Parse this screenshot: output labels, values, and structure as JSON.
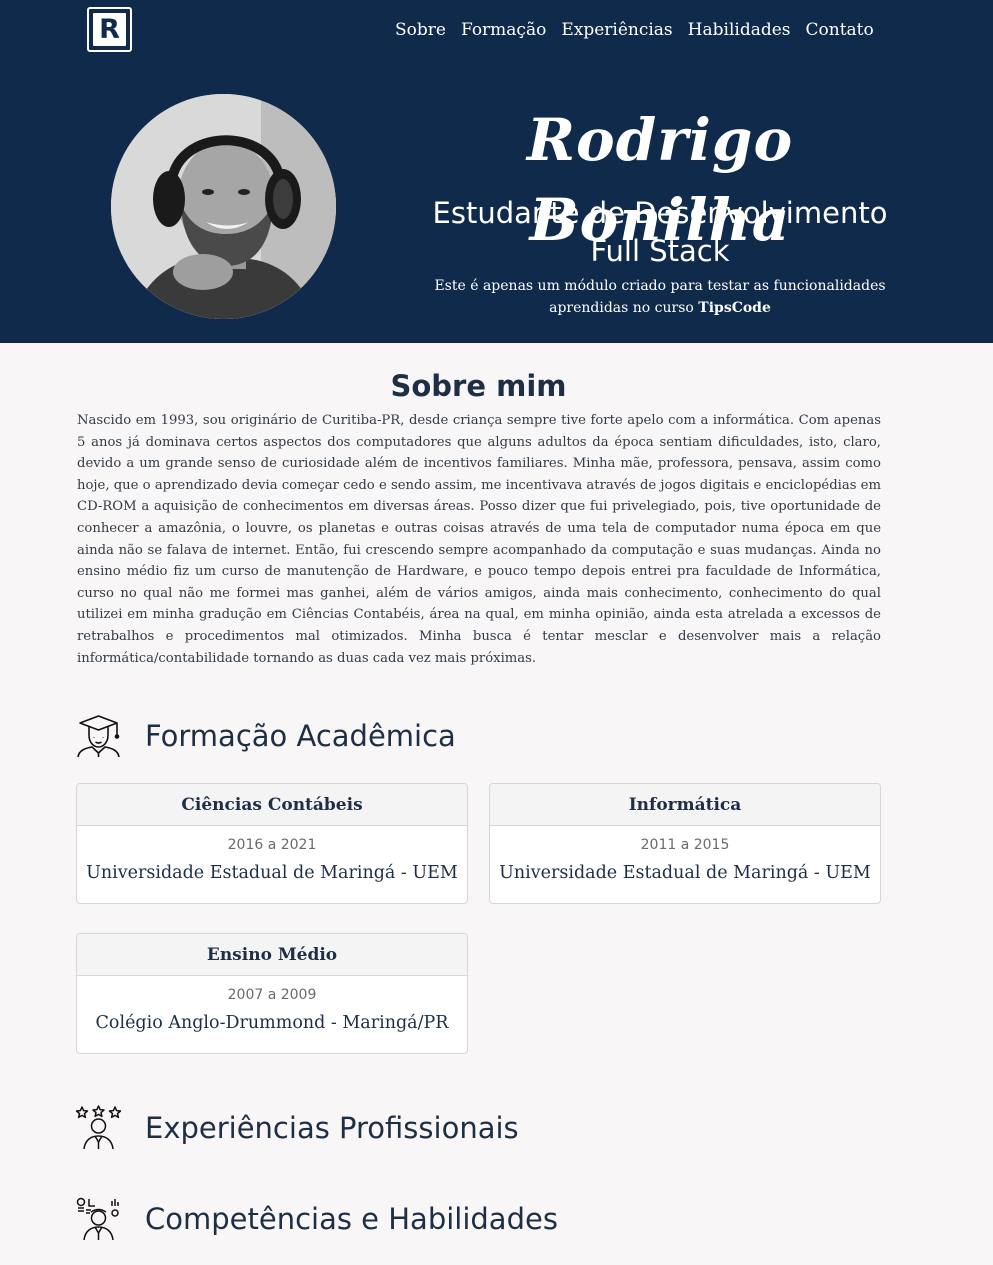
{
  "header": {
    "logo_letter": "R",
    "nav": [
      "Sobre",
      "Formação",
      "Experiências",
      "Habilidades",
      "Contato"
    ],
    "name": "Rodrigo Bonilha",
    "role": "Estudante de Desenvolvimento Full Stack",
    "desc_prefix": "Este é apenas um módulo criado para testar as funcionalidades aprendidas no curso",
    "desc_brand": "TipsCode",
    "bg_color": "#0f2a4b"
  },
  "about": {
    "title": "Sobre mim",
    "text": "Nascido em 1993, sou originário de Curitiba-PR, desde criança sempre tive forte apelo com a informática. Com apenas 5 anos já dominava certos aspectos dos computadores que alguns adultos da época sentiam dificuldades, isto, claro, devido a um grande senso de curiosidade além de incentivos familiares. Minha mãe, professora, pensava, assim como hoje, que o aprendizado devia começar cedo e sendo assim, me incentivava através de jogos digitais e enciclopédias em CD-ROM a aquisição de conhecimentos em diversas áreas. Posso dizer que fui privelegiado, pois, tive oportunidade de conhecer a amazônia, o louvre, os planetas e outras coisas através de uma tela de computador numa época em que ainda não se falava de internet. Então, fui crescendo sempre acompanhado da computação e suas mudanças. Ainda no ensino médio fiz um curso de manutenção de Hardware, e pouco tempo depois entrei pra faculdade de Informática, curso no qual não me formei mas ganhei, além de vários amigos, ainda mais conhecimento, conhecimento do qual utilizei em minha gradução em Ciências Contabéis, área na qual, em minha opinião, ainda esta atrelada a excessos de retrabalhos e procedimentos mal otimizados. Minha busca é tentar mesclar e desenvolver mais a relação informática/contabilidade tornando as duas cada vez mais próximas."
  },
  "education": {
    "title": "Formação Acadêmica",
    "icon": "graduate-icon",
    "items": [
      {
        "course": "Ciências Contábeis",
        "period": "2016 a 2021",
        "school": "Universidade Estadual de Maringá - UEM"
      },
      {
        "course": "Informática",
        "period": "2011 a 2015",
        "school": "Universidade Estadual de Maringá - UEM"
      },
      {
        "course": "Ensino Médio",
        "period": "2007 a 2009",
        "school": "Colégio Anglo-Drummond - Maringá/PR"
      }
    ]
  },
  "experience": {
    "title": "Experiências Profissionais",
    "icon": "professional-stars-icon"
  },
  "skills": {
    "title": "Competências e Habilidades",
    "icon": "skills-icon"
  }
}
